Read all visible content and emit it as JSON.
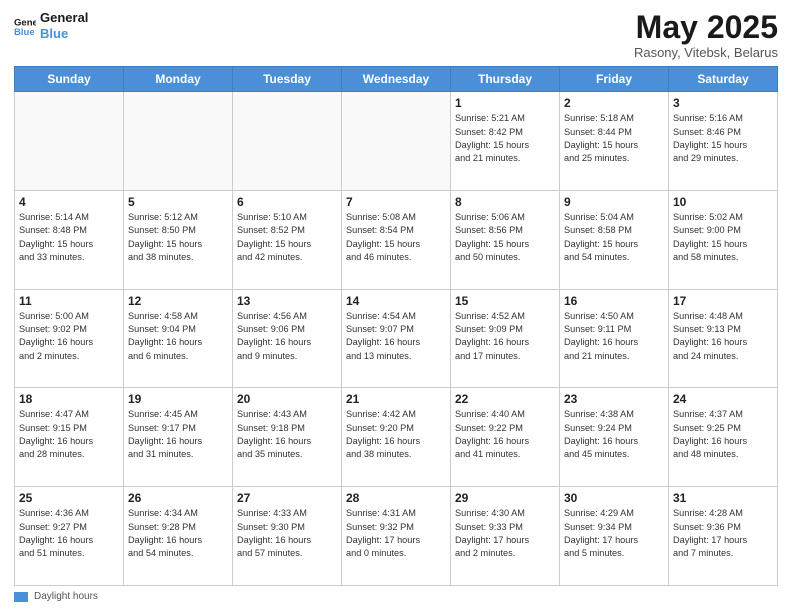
{
  "header": {
    "logo_line1": "General",
    "logo_line2": "Blue",
    "month": "May 2025",
    "location": "Rasony, Vitebsk, Belarus"
  },
  "days_of_week": [
    "Sunday",
    "Monday",
    "Tuesday",
    "Wednesday",
    "Thursday",
    "Friday",
    "Saturday"
  ],
  "weeks": [
    [
      {
        "day": "",
        "info": ""
      },
      {
        "day": "",
        "info": ""
      },
      {
        "day": "",
        "info": ""
      },
      {
        "day": "",
        "info": ""
      },
      {
        "day": "1",
        "info": "Sunrise: 5:21 AM\nSunset: 8:42 PM\nDaylight: 15 hours\nand 21 minutes."
      },
      {
        "day": "2",
        "info": "Sunrise: 5:18 AM\nSunset: 8:44 PM\nDaylight: 15 hours\nand 25 minutes."
      },
      {
        "day": "3",
        "info": "Sunrise: 5:16 AM\nSunset: 8:46 PM\nDaylight: 15 hours\nand 29 minutes."
      }
    ],
    [
      {
        "day": "4",
        "info": "Sunrise: 5:14 AM\nSunset: 8:48 PM\nDaylight: 15 hours\nand 33 minutes."
      },
      {
        "day": "5",
        "info": "Sunrise: 5:12 AM\nSunset: 8:50 PM\nDaylight: 15 hours\nand 38 minutes."
      },
      {
        "day": "6",
        "info": "Sunrise: 5:10 AM\nSunset: 8:52 PM\nDaylight: 15 hours\nand 42 minutes."
      },
      {
        "day": "7",
        "info": "Sunrise: 5:08 AM\nSunset: 8:54 PM\nDaylight: 15 hours\nand 46 minutes."
      },
      {
        "day": "8",
        "info": "Sunrise: 5:06 AM\nSunset: 8:56 PM\nDaylight: 15 hours\nand 50 minutes."
      },
      {
        "day": "9",
        "info": "Sunrise: 5:04 AM\nSunset: 8:58 PM\nDaylight: 15 hours\nand 54 minutes."
      },
      {
        "day": "10",
        "info": "Sunrise: 5:02 AM\nSunset: 9:00 PM\nDaylight: 15 hours\nand 58 minutes."
      }
    ],
    [
      {
        "day": "11",
        "info": "Sunrise: 5:00 AM\nSunset: 9:02 PM\nDaylight: 16 hours\nand 2 minutes."
      },
      {
        "day": "12",
        "info": "Sunrise: 4:58 AM\nSunset: 9:04 PM\nDaylight: 16 hours\nand 6 minutes."
      },
      {
        "day": "13",
        "info": "Sunrise: 4:56 AM\nSunset: 9:06 PM\nDaylight: 16 hours\nand 9 minutes."
      },
      {
        "day": "14",
        "info": "Sunrise: 4:54 AM\nSunset: 9:07 PM\nDaylight: 16 hours\nand 13 minutes."
      },
      {
        "day": "15",
        "info": "Sunrise: 4:52 AM\nSunset: 9:09 PM\nDaylight: 16 hours\nand 17 minutes."
      },
      {
        "day": "16",
        "info": "Sunrise: 4:50 AM\nSunset: 9:11 PM\nDaylight: 16 hours\nand 21 minutes."
      },
      {
        "day": "17",
        "info": "Sunrise: 4:48 AM\nSunset: 9:13 PM\nDaylight: 16 hours\nand 24 minutes."
      }
    ],
    [
      {
        "day": "18",
        "info": "Sunrise: 4:47 AM\nSunset: 9:15 PM\nDaylight: 16 hours\nand 28 minutes."
      },
      {
        "day": "19",
        "info": "Sunrise: 4:45 AM\nSunset: 9:17 PM\nDaylight: 16 hours\nand 31 minutes."
      },
      {
        "day": "20",
        "info": "Sunrise: 4:43 AM\nSunset: 9:18 PM\nDaylight: 16 hours\nand 35 minutes."
      },
      {
        "day": "21",
        "info": "Sunrise: 4:42 AM\nSunset: 9:20 PM\nDaylight: 16 hours\nand 38 minutes."
      },
      {
        "day": "22",
        "info": "Sunrise: 4:40 AM\nSunset: 9:22 PM\nDaylight: 16 hours\nand 41 minutes."
      },
      {
        "day": "23",
        "info": "Sunrise: 4:38 AM\nSunset: 9:24 PM\nDaylight: 16 hours\nand 45 minutes."
      },
      {
        "day": "24",
        "info": "Sunrise: 4:37 AM\nSunset: 9:25 PM\nDaylight: 16 hours\nand 48 minutes."
      }
    ],
    [
      {
        "day": "25",
        "info": "Sunrise: 4:36 AM\nSunset: 9:27 PM\nDaylight: 16 hours\nand 51 minutes."
      },
      {
        "day": "26",
        "info": "Sunrise: 4:34 AM\nSunset: 9:28 PM\nDaylight: 16 hours\nand 54 minutes."
      },
      {
        "day": "27",
        "info": "Sunrise: 4:33 AM\nSunset: 9:30 PM\nDaylight: 16 hours\nand 57 minutes."
      },
      {
        "day": "28",
        "info": "Sunrise: 4:31 AM\nSunset: 9:32 PM\nDaylight: 17 hours\nand 0 minutes."
      },
      {
        "day": "29",
        "info": "Sunrise: 4:30 AM\nSunset: 9:33 PM\nDaylight: 17 hours\nand 2 minutes."
      },
      {
        "day": "30",
        "info": "Sunrise: 4:29 AM\nSunset: 9:34 PM\nDaylight: 17 hours\nand 5 minutes."
      },
      {
        "day": "31",
        "info": "Sunrise: 4:28 AM\nSunset: 9:36 PM\nDaylight: 17 hours\nand 7 minutes."
      }
    ]
  ],
  "footer": {
    "legend_label": "Daylight hours"
  }
}
